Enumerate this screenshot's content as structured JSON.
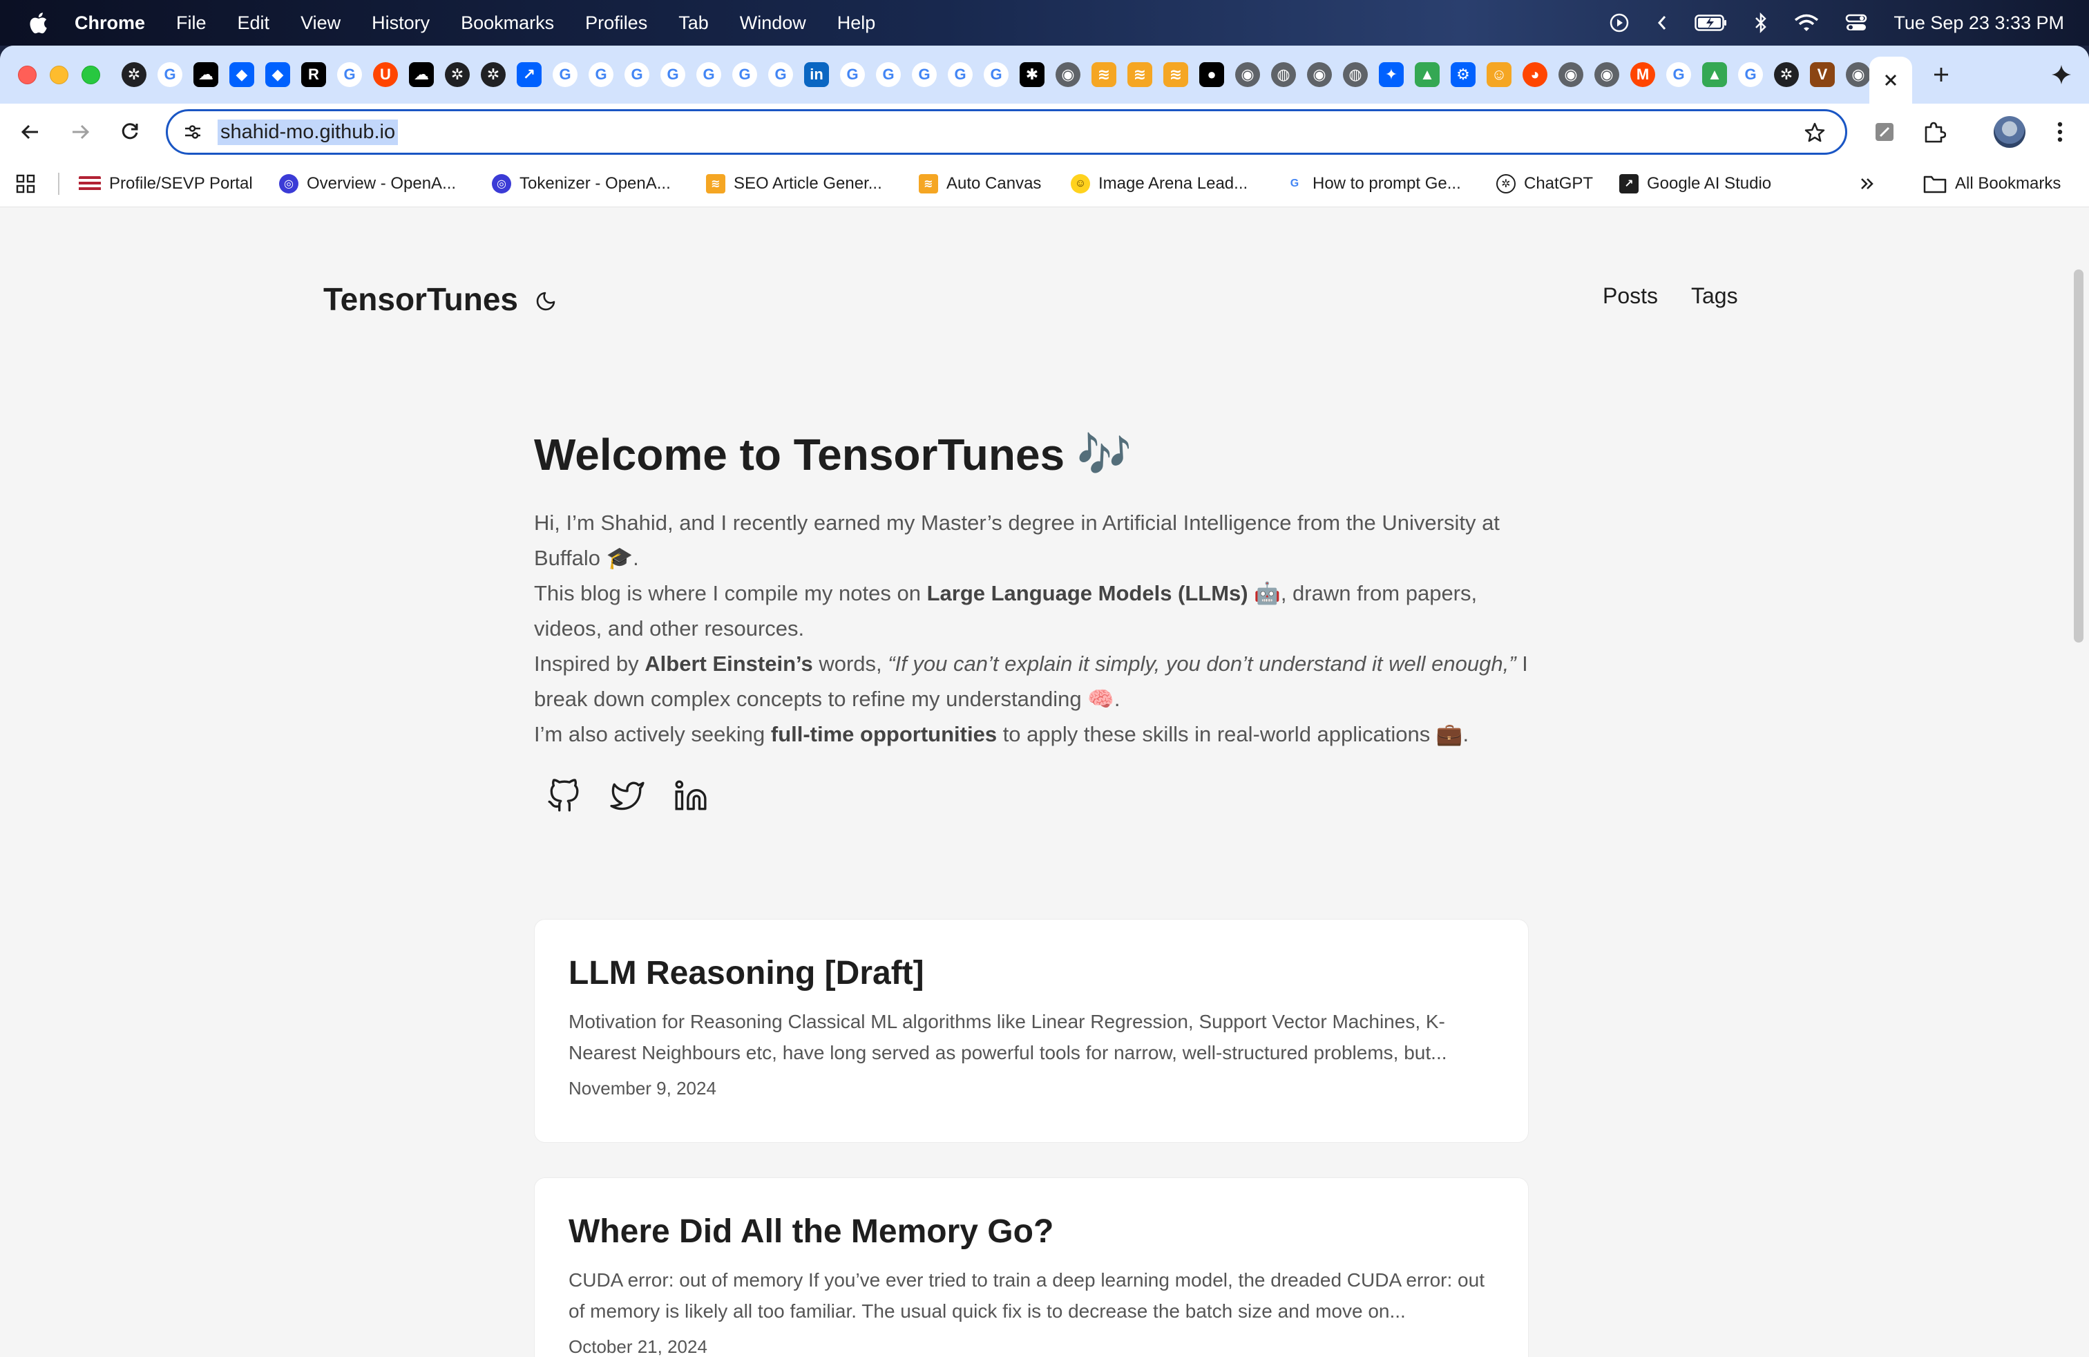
{
  "menubar": {
    "app": "Chrome",
    "items": [
      "File",
      "Edit",
      "View",
      "History",
      "Bookmarks",
      "Profiles",
      "Tab",
      "Window",
      "Help"
    ],
    "clock": "Tue Sep 23  3:33 PM"
  },
  "tabs": {
    "favicon_count": 48,
    "icons": [
      "openai-icon",
      "google-icon",
      "cloud-icon",
      "dropbox-icon",
      "dropbox-icon",
      "replit-icon",
      "google-icon",
      "usn-icon",
      "cloud-icon",
      "openai-icon",
      "openai-icon",
      "arrow-icon",
      "google-icon",
      "google-icon",
      "google-icon",
      "google-icon",
      "google-icon",
      "google-icon",
      "google-icon",
      "linkedin-icon",
      "google-icon",
      "google-icon",
      "google-icon",
      "google-icon",
      "google-icon",
      "bug-icon",
      "chrome-icon",
      "stack-icon",
      "stack-icon",
      "stack-icon",
      "dark-icon",
      "chrome-icon",
      "globe-icon",
      "chrome-icon",
      "globe-icon",
      "gemini-icon",
      "drive-icon",
      "gear-icon",
      "hugging-face-icon",
      "reddit-icon",
      "chrome-icon",
      "chrome-icon",
      "gmail-icon",
      "google-icon",
      "drive-icon",
      "google-icon",
      "openai-icon",
      "v-icon",
      "chrome-icon"
    ]
  },
  "toolbar": {
    "url": "shahid-mo.github.io"
  },
  "bookmarks": {
    "items": [
      {
        "label": "Profile/SEVP Portal"
      },
      {
        "label": "Overview - OpenA..."
      },
      {
        "label": "Tokenizer - OpenA..."
      },
      {
        "label": "SEO Article Gener..."
      },
      {
        "label": "Auto Canvas"
      },
      {
        "label": "Image Arena Lead..."
      },
      {
        "label": "How to prompt Ge..."
      },
      {
        "label": "ChatGPT"
      },
      {
        "label": "Google AI Studio"
      }
    ],
    "all": "All Bookmarks"
  },
  "site": {
    "title": "TensorTunes",
    "nav": [
      "Posts",
      "Tags"
    ]
  },
  "hero": {
    "heading": "Welcome to TensorTunes 🎶",
    "p1a": "Hi, I’m Shahid, and I recently earned my Master’s degree in Artificial Intelligence from the University at Buffalo 🎓.",
    "p2a": "This blog is where I compile my notes on ",
    "p2b": "Large Language Models (LLMs)",
    "p2c": " 🤖, drawn from papers, videos, and other resources.",
    "p3a": "Inspired by ",
    "p3b": "Albert Einstein’s",
    "p3c": " words, ",
    "p3d": "“If you can’t explain it simply, you don’t understand it well enough,”",
    "p3e": " I break down complex concepts to refine my understanding 🧠.",
    "p4a": "I’m also actively seeking ",
    "p4b": "full-time opportunities",
    "p4c": " to apply these skills in real-world applications 💼."
  },
  "posts": [
    {
      "title": "LLM Reasoning [Draft]",
      "excerpt": "Motivation for Reasoning Classical ML algorithms like Linear Regression, Support Vector Machines, K-Nearest Neighbours etc, have long served as powerful tools for narrow, well-structured problems, but...",
      "date": "November 9, 2024"
    },
    {
      "title": "Where Did All the Memory Go?",
      "excerpt": "CUDA error: out of memory If you’ve ever tried to train a deep learning model, the dreaded CUDA error: out of memory is likely all too familiar. The usual quick fix is to decrease the batch size and move on...",
      "date": "October 21, 2024"
    }
  ]
}
